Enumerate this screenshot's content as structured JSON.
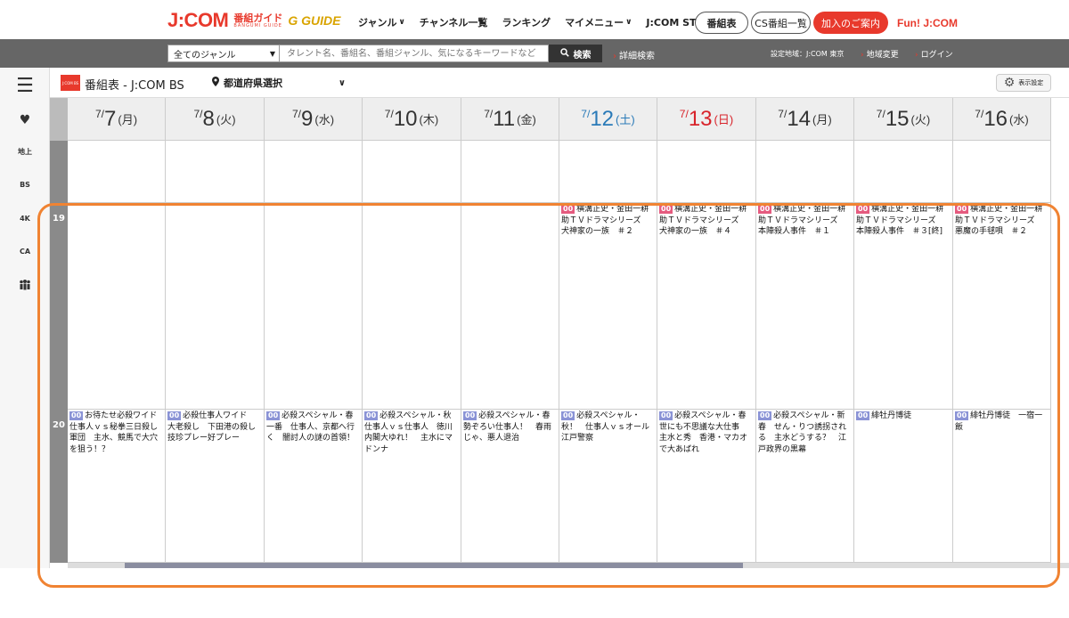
{
  "brand": {
    "logo_text": "J:COM",
    "logo_sub": "番組ガイド",
    "logo_roman": "BANGUMI GUIDE",
    "gguide": "G GUIDE"
  },
  "nav": {
    "items": [
      "ジャンル",
      "チャンネル一覧",
      "ランキング",
      "マイメニュー",
      "J:COM STREAM"
    ],
    "program_table": "番組表",
    "cs_table": "CS番組一覧",
    "join": "加入のご案内",
    "fun": "Fun! J:COM"
  },
  "search": {
    "genre_value": "全てのジャンル",
    "placeholder": "タレント名、番組名、番組ジャンル、気になるキーワードなど",
    "button": "検索",
    "advanced": "詳細検索",
    "region": "設定地域：J:COM 東京",
    "change_region": "地域変更",
    "login": "ログイン"
  },
  "subheader": {
    "channel_logo": "J:COM BS",
    "title": "番組表 - J:COM BS",
    "prefecture": "都道府県選択",
    "settings": "表示設定"
  },
  "rail": {
    "items": [
      "地上",
      "BS",
      "4K",
      "CA"
    ]
  },
  "days": [
    {
      "m": "7",
      "d": "7",
      "w": "(月)",
      "color": "#333333"
    },
    {
      "m": "7",
      "d": "8",
      "w": "(火)",
      "color": "#333333"
    },
    {
      "m": "7",
      "d": "9",
      "w": "(水)",
      "color": "#333333"
    },
    {
      "m": "7",
      "d": "10",
      "w": "(木)",
      "color": "#333333"
    },
    {
      "m": "7",
      "d": "11",
      "w": "(金)",
      "color": "#333333"
    },
    {
      "m": "7",
      "d": "12",
      "w": "(土)",
      "color": "#2a7ab8"
    },
    {
      "m": "7",
      "d": "13",
      "w": "(日)",
      "color": "#d8232a"
    },
    {
      "m": "7",
      "d": "14",
      "w": "(月)",
      "color": "#333333"
    },
    {
      "m": "7",
      "d": "15",
      "w": "(火)",
      "color": "#333333"
    },
    {
      "m": "7",
      "d": "16",
      "w": "(水)",
      "color": "#333333"
    }
  ],
  "hours": [
    "19",
    "20"
  ],
  "programs_19": [
    null,
    null,
    null,
    null,
    null,
    {
      "min": "00",
      "title": "横溝正史・金田一耕助ＴＶドラマシリーズ　犬神家の一族　＃２"
    },
    {
      "min": "00",
      "title": "横溝正史・金田一耕助ＴＶドラマシリーズ　犬神家の一族　＃４"
    },
    {
      "min": "00",
      "title": "横溝正史・金田一耕助ＴＶドラマシリーズ　本陣殺人事件　＃１"
    },
    {
      "min": "00",
      "title": "横溝正史・金田一耕助ＴＶドラマシリーズ　本陣殺人事件　＃３[終]"
    },
    {
      "min": "00",
      "title": "横溝正史・金田一耕助ＴＶドラマシリーズ　悪魔の手毬唄　＃２"
    }
  ],
  "programs_20": [
    {
      "min": "00",
      "title": "お待たせ必殺ワイド　仕事人ｖｓ秘拳三日殺し軍団　主水、競馬で大穴を狙う！？"
    },
    {
      "min": "00",
      "title": "必殺仕事人ワイド　大老殺し　下田港の殺し技珍プレー好プレー"
    },
    {
      "min": "00",
      "title": "必殺スペシャル・春一番　仕事人、京都へ行く　闇討人の謎の首領！"
    },
    {
      "min": "00",
      "title": "必殺スペシャル・秋　仕事人ｖｓ仕事人　徳川内閣大ゆれ！　主水にマドンナ"
    },
    {
      "min": "00",
      "title": "必殺スペシャル・春　勢ぞろい仕事人！　春雨じゃ、悪人退治"
    },
    {
      "min": "00",
      "title": "必殺スペシャル・秋！　仕事人ｖｓオール江戸警察"
    },
    {
      "min": "00",
      "title": "必殺スペシャル・春　世にも不思議な大仕事　主水と秀　香港・マカオで大あばれ"
    },
    {
      "min": "00",
      "title": "必殺スペシャル・新春　せん・りつ誘拐される　主水どうする？　江戸政界の黒幕"
    },
    {
      "min": "00",
      "title": "緋牡丹博徒"
    },
    {
      "min": "00",
      "title": "緋牡丹博徒　一宿一飯"
    }
  ]
}
